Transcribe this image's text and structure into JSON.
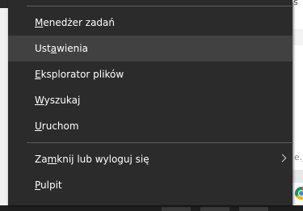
{
  "menu": {
    "items": [
      {
        "before": "",
        "mnemonic": "M",
        "after": "enedżer zadań"
      },
      {
        "before": "Ust",
        "mnemonic": "a",
        "after": "wienia"
      },
      {
        "before": "",
        "mnemonic": "E",
        "after": "ksplorator plików"
      },
      {
        "before": "",
        "mnemonic": "W",
        "after": "yszukaj"
      },
      {
        "before": "",
        "mnemonic": "U",
        "after": "ruchom"
      },
      {
        "before": "Za",
        "mnemonic": "m",
        "after": "knij lub wyloguj się"
      },
      {
        "before": "",
        "mnemonic": "P",
        "after": "ulpit"
      }
    ],
    "highlighted_item": "Ustawienia",
    "submenu_arrow_item": "Zamknij lub wyloguj się"
  },
  "background": {
    "fragment_top": "s",
    "fragment_mid": "e.j"
  },
  "colors": {
    "menu_bg": "#2b2b2b",
    "highlight_bg": "#414141",
    "separator": "#5e5e5e",
    "text": "#ffffff"
  },
  "icons": {
    "taskbar_corner": "chrome-icon",
    "submenu": "chevron-right-icon"
  }
}
